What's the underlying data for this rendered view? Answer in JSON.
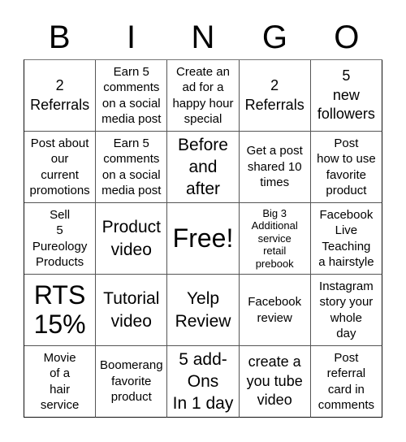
{
  "header": {
    "letters": [
      "B",
      "I",
      "N",
      "G",
      "O"
    ]
  },
  "cells": [
    {
      "text": "2\nReferrals",
      "size": "lg"
    },
    {
      "text": "Earn 5\ncomments\non a social\nmedia post",
      "size": "md"
    },
    {
      "text": "Create an\nad for a\nhappy hour\nspecial",
      "size": "md"
    },
    {
      "text": "2\nReferrals",
      "size": "lg"
    },
    {
      "text": "5\nnew\nfollowers",
      "size": "lg"
    },
    {
      "text": "Post about\nour\ncurrent\npromotions",
      "size": "md"
    },
    {
      "text": "Earn 5\ncomments\non a social\nmedia post",
      "size": "md"
    },
    {
      "text": "Before\nand\nafter",
      "size": "xl"
    },
    {
      "text": "Get a post\nshared 10\ntimes",
      "size": "md"
    },
    {
      "text": "Post\nhow to use\nfavorite\nproduct",
      "size": "md"
    },
    {
      "text": "Sell\n5\nPureology\nProducts",
      "size": "md"
    },
    {
      "text": "Product\nvideo",
      "size": "xl"
    },
    {
      "text": "Free!",
      "size": "free"
    },
    {
      "text": "Big 3\nAdditional\nservice\nretail\nprebook",
      "size": "sm"
    },
    {
      "text": "Facebook\nLive\nTeaching\na hairstyle",
      "size": "md"
    },
    {
      "text": "RTS\n15%",
      "size": "xxl"
    },
    {
      "text": "Tutorial\nvideo",
      "size": "xl"
    },
    {
      "text": "Yelp\nReview",
      "size": "xl"
    },
    {
      "text": "Facebook\nreview",
      "size": "md"
    },
    {
      "text": "Instagram\nstory your\nwhole\nday",
      "size": "md"
    },
    {
      "text": "Movie\nof a\nhair\nservice",
      "size": "md"
    },
    {
      "text": "Boomerang\nfavorite\nproduct",
      "size": "md"
    },
    {
      "text": "5 add-\nOns\nIn 1 day",
      "size": "xl"
    },
    {
      "text": "create a\nyou tube\nvideo",
      "size": "lg"
    },
    {
      "text": "Post\nreferral\ncard in\ncomments",
      "size": "md"
    }
  ]
}
